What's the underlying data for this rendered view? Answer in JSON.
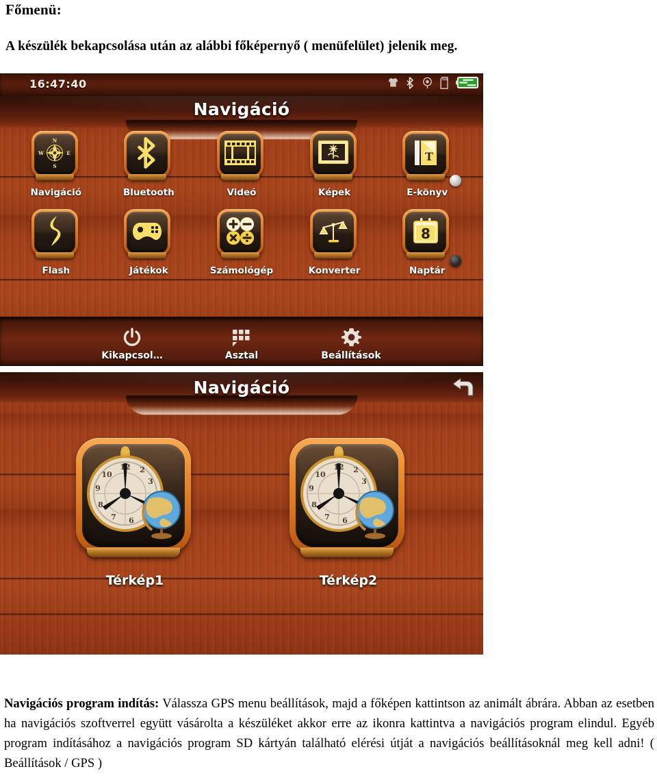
{
  "document": {
    "heading": "Főmenü:",
    "intro": "A készülék bekapcsolása után az alábbi főképernyő ( menüfelület) jelenik meg.",
    "footer_bold": "Navigációs program indítás:",
    "footer_text": " Válassza  GPS menu beállítások, majd a főképen kattintson  az animált ábrára. Abban az esetben ha navigációs szoftverrel együtt vásárolta a készüléket akkor erre az ikonra kattintva a navigációs program elindul. Egyéb program indításához a navigációs program SD kártyán található elérési útját a navigációs beállításoknál meg kell adni! ( Beállítások / GPS )"
  },
  "colors": {
    "wood_dark": "#8c3312",
    "wood_light": "#ab451b",
    "tile_border": "#e8852c",
    "glyph_yellow": "#f7e06a",
    "battery_green": "#3cd63c",
    "label_white": "#ffffff"
  },
  "menu_screen": {
    "statusbar": {
      "clock": "16:47:40",
      "icons": [
        "shirt-icon",
        "bluetooth-icon",
        "gps-signal-icon",
        "sd-card-icon",
        "battery-icon"
      ]
    },
    "title": "Navigáció",
    "apps": [
      {
        "label": "Navigáció",
        "icon": "compass-icon"
      },
      {
        "label": "Bluetooth",
        "icon": "bluetooth-icon"
      },
      {
        "label": "Videó",
        "icon": "filmstrip-icon"
      },
      {
        "label": "Képek",
        "icon": "photo-flower-icon"
      },
      {
        "label": "E-könyv",
        "icon": "ebook-icon"
      },
      {
        "label": "Flash",
        "icon": "flash-lightning-icon"
      },
      {
        "label": "Játékok",
        "icon": "gamepad-icon"
      },
      {
        "label": "Számológép",
        "icon": "calculator-icon"
      },
      {
        "label": "Konverter",
        "icon": "scales-icon"
      },
      {
        "label": "Naptár",
        "icon": "calendar-icon",
        "day": "8"
      }
    ],
    "dock": [
      {
        "label": "Kikapcsol…",
        "icon": "power-icon"
      },
      {
        "label": "Asztal",
        "icon": "grid-desktop-icon"
      },
      {
        "label": "Beállítások",
        "icon": "gear-icon"
      }
    ]
  },
  "nav_screen": {
    "title": "Navigáció",
    "back_icon": "back-arrow-icon",
    "maps": [
      {
        "label": "Térkép1",
        "icon": "compass-globe-icon"
      },
      {
        "label": "Térkép2",
        "icon": "compass-globe-icon"
      }
    ]
  }
}
